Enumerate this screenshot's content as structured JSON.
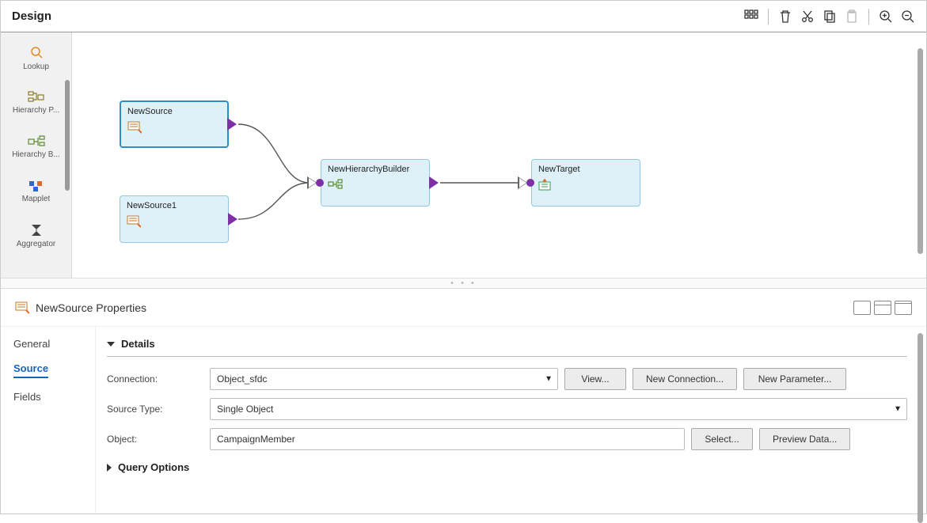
{
  "toolbar": {
    "title": "Design"
  },
  "palette": {
    "items": [
      {
        "label": "Lookup"
      },
      {
        "label": "Hierarchy P..."
      },
      {
        "label": "Hierarchy B..."
      },
      {
        "label": "Mapplet"
      },
      {
        "label": "Aggregator"
      }
    ]
  },
  "canvas": {
    "nodes": {
      "source": {
        "label": "NewSource"
      },
      "source1": {
        "label": "NewSource1"
      },
      "hbuilder": {
        "label": "NewHierarchyBuilder"
      },
      "target": {
        "label": "NewTarget"
      }
    }
  },
  "properties": {
    "title": "NewSource Properties",
    "tabs": {
      "general": "General",
      "source": "Source",
      "fields": "Fields"
    },
    "sections": {
      "details": "Details",
      "query": "Query Options"
    },
    "labels": {
      "connection": "Connection:",
      "sourceType": "Source Type:",
      "object": "Object:"
    },
    "values": {
      "connection": "Object_sfdc",
      "sourceType": "Single Object",
      "object": "CampaignMember"
    },
    "buttons": {
      "view": "View...",
      "newConnection": "New Connection...",
      "newParameter": "New Parameter...",
      "select": "Select...",
      "preview": "Preview Data..."
    }
  }
}
